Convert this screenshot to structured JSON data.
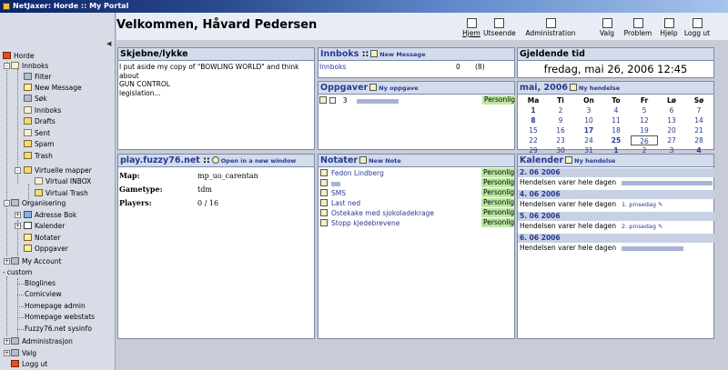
{
  "window": {
    "title": "NetJaxer: Horde :: My Portal"
  },
  "sidebar": {
    "items": [
      {
        "label": "Horde"
      },
      {
        "label": "Innboks"
      },
      {
        "label": "Filter"
      },
      {
        "label": "New Message"
      },
      {
        "label": "Søk"
      },
      {
        "label": "Innboks"
      },
      {
        "label": "Drafts"
      },
      {
        "label": "Sent"
      },
      {
        "label": "Spam"
      },
      {
        "label": "Trash"
      },
      {
        "label": "Virtuelle mapper"
      },
      {
        "label": "Virtual INBOX"
      },
      {
        "label": "Virtual Trash"
      },
      {
        "label": "Organisering"
      },
      {
        "label": "Adresse Bok"
      },
      {
        "label": "Kalender"
      },
      {
        "label": "Notater"
      },
      {
        "label": "Oppgaver"
      },
      {
        "label": "My Account"
      },
      {
        "label": "custom"
      },
      {
        "label": "Bloglines"
      },
      {
        "label": "Comicview"
      },
      {
        "label": "Homepage admin"
      },
      {
        "label": "Homepage webstats"
      },
      {
        "label": "Fuzzy76.net sysinfo"
      },
      {
        "label": "Administrasjon"
      },
      {
        "label": "Valg"
      },
      {
        "label": "Logg ut"
      }
    ]
  },
  "header": {
    "greeting": "Velkommen, Håvard Pedersen",
    "toolbar": [
      {
        "label": "Hjem",
        "icon": "home-icon"
      },
      {
        "label": "Utseende",
        "icon": "layout-icon"
      },
      {
        "label": "Administration",
        "icon": "admin-icon"
      },
      {
        "label": "Valg",
        "icon": "options-icon"
      },
      {
        "label": "Problem",
        "icon": "problem-icon"
      },
      {
        "label": "Hjelp",
        "icon": "help-icon"
      },
      {
        "label": "Logg ut",
        "icon": "logout-icon"
      }
    ]
  },
  "skjebne": {
    "title": "Skjebne/lykke",
    "lines": [
      "I put aside my copy of \"BOWLING WORLD\" and think about",
      "GUN CONTROL",
      "legislation..."
    ]
  },
  "innboks": {
    "title": "Innboks",
    "sep": "::",
    "action": "New Message",
    "folder": "Innboks",
    "unread": "0",
    "total": "(8)"
  },
  "gjeldende": {
    "title": "Gjeldende tid",
    "time": "fredag, mai 26, 2006 12:45"
  },
  "oppgaver": {
    "title": "Oppgaver",
    "action": "Ny oppgave",
    "task_priority": "3",
    "task_category": "Personlig"
  },
  "kalendermini": {
    "title": "mai, 2006",
    "action": "Ny hendelse",
    "weekdays": [
      "Ma",
      "Ti",
      "On",
      "To",
      "Fr",
      "Lø",
      "Sø"
    ],
    "weeks": [
      [
        "1",
        "2",
        "3",
        "4",
        "5",
        "6",
        "7"
      ],
      [
        "8",
        "9",
        "10",
        "11",
        "12",
        "13",
        "14"
      ],
      [
        "15",
        "16",
        "17",
        "18",
        "19",
        "20",
        "21"
      ],
      [
        "22",
        "23",
        "24",
        "25",
        "26",
        "27",
        "28"
      ],
      [
        "29",
        "30",
        "31",
        "1",
        "2",
        "3",
        "4"
      ]
    ]
  },
  "fuzzy": {
    "title": "play.fuzzy76.net",
    "sep": "::",
    "action": "Open in a new window",
    "map_label": "Map:",
    "map_value": "mp_uo_carentan",
    "gametype_label": "Gametype:",
    "gametype_value": "tdm",
    "players_label": "Players:",
    "players_value": "0 / 16"
  },
  "notater": {
    "title": "Notater",
    "action": "New Note",
    "items": [
      {
        "label": "Fedon Lindberg",
        "category": "Personlig"
      },
      {
        "label": "",
        "category": "Personlig"
      },
      {
        "label": "SMS",
        "category": "Personlig"
      },
      {
        "label": "Last ned",
        "category": "Personlig"
      },
      {
        "label": "Ostekake med sjokoladekrage",
        "category": "Personlig"
      },
      {
        "label": "Stopp kjedebrevene",
        "category": "Personlig"
      }
    ]
  },
  "kalender": {
    "title": "Kalender",
    "action": "Ny hendelse",
    "days": [
      {
        "date": "2. 06 2006",
        "text": "Hendelsen varer hele dagen",
        "extra": ""
      },
      {
        "date": "4. 06 2006",
        "text": "Hendelsen varer hele dagen",
        "extra": "1. pinsedag"
      },
      {
        "date": "5. 06 2006",
        "text": "Hendelsen varer hele dagen",
        "extra": "2. pinsedag"
      },
      {
        "date": "6. 06 2006",
        "text": "Hendelsen varer hele dagen",
        "extra": ""
      }
    ]
  },
  "colors": {
    "accent": "#2a3a90",
    "badge": "#bde8a4",
    "header": "#d4dcec"
  }
}
